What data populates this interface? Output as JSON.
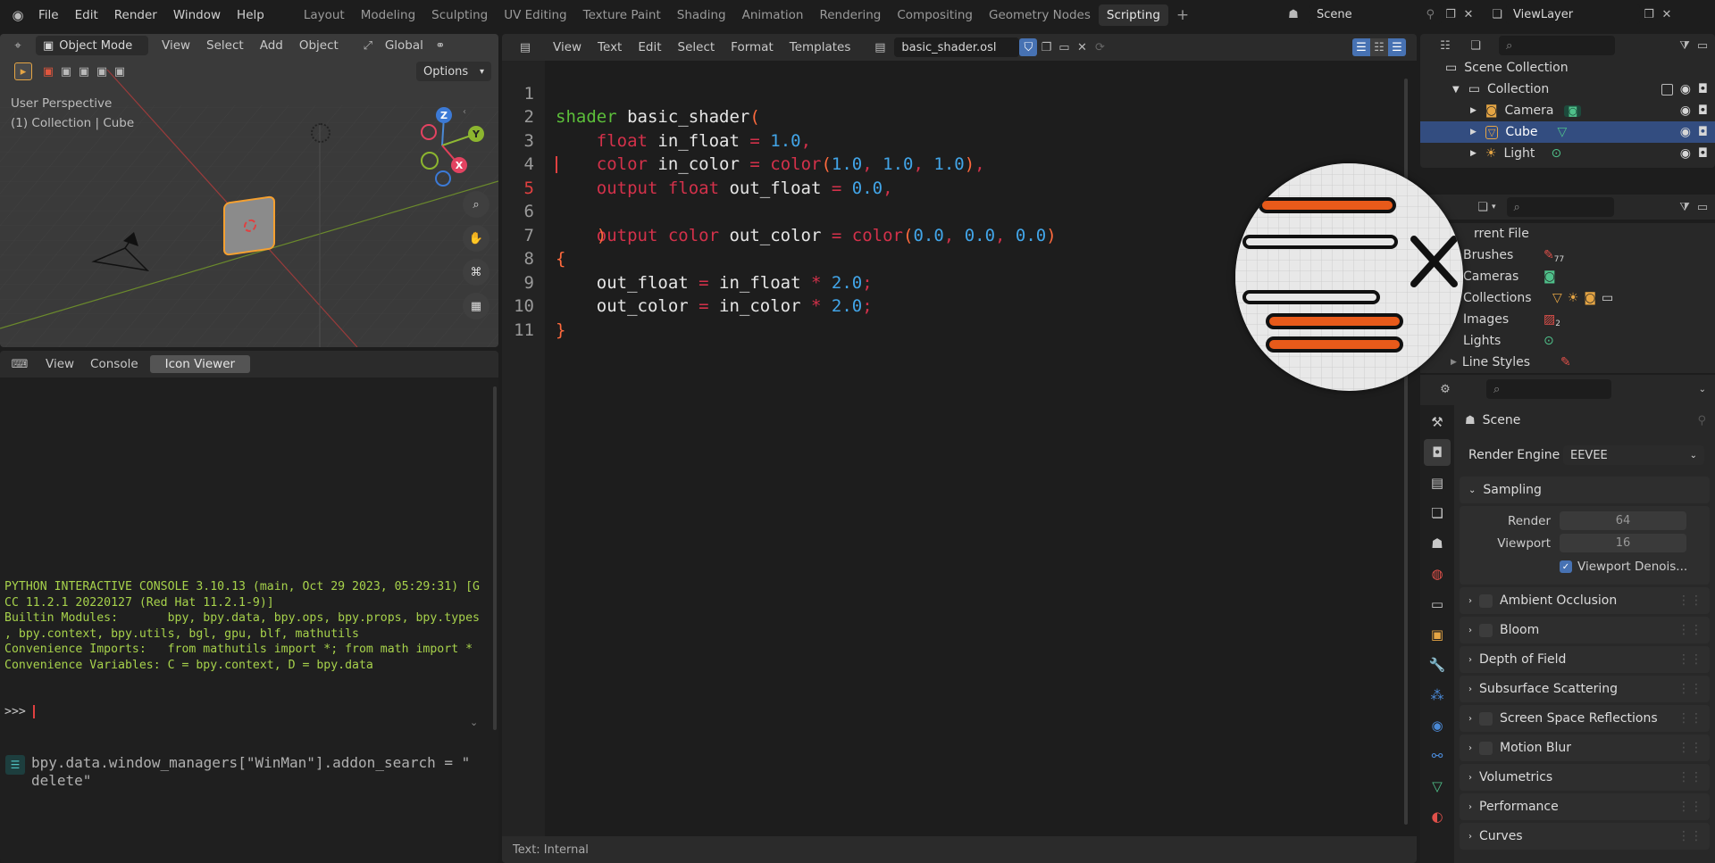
{
  "topbar": {
    "menu": [
      "File",
      "Edit",
      "Render",
      "Window",
      "Help"
    ],
    "workspaces": [
      "Layout",
      "Modeling",
      "Sculpting",
      "UV Editing",
      "Texture Paint",
      "Shading",
      "Animation",
      "Rendering",
      "Compositing",
      "Geometry Nodes",
      "Scripting"
    ],
    "active_workspace": "Scripting",
    "add_label": "+",
    "scene_name": "Scene",
    "view_layer": "ViewLayer"
  },
  "viewport": {
    "mode": "Object Mode",
    "menus": [
      "View",
      "Select",
      "Add",
      "Object"
    ],
    "transform": "Global",
    "options": "Options",
    "perspective": "User Perspective",
    "collection_info": "(1) Collection | Cube",
    "gizmo": {
      "z": "Z",
      "y": "Y",
      "x": "X"
    }
  },
  "console": {
    "menus": [
      "View",
      "Console",
      "Icon Viewer"
    ],
    "active_tab": "Icon Viewer",
    "lines": [
      "PYTHON INTERACTIVE CONSOLE 3.10.13 (main, Oct 29 2023, 05:29:31) [G",
      "CC 11.2.1 20220127 (Red Hat 11.2.1-9)]",
      "",
      "Builtin Modules:       bpy, bpy.data, bpy.ops, bpy.props, bpy.types",
      ", bpy.context, bpy.utils, bgl, gpu, blf, mathutils",
      "Convenience Imports:   from mathutils import *; from math import *",
      "Convenience Variables: C = bpy.context, D = bpy.data"
    ],
    "prompt": ">>> ",
    "info_line1": "bpy.data.window_managers[\"WinMan\"].addon_search = \"",
    "info_line2": "delete\""
  },
  "editor": {
    "menus": [
      "View",
      "Text",
      "Edit",
      "Select",
      "Format",
      "Templates"
    ],
    "filename": "basic_shader.osl",
    "status": "Text: Internal",
    "line_numbers": [
      "1",
      "2",
      "3",
      "4",
      "5",
      "6",
      "7",
      "8",
      "9",
      "10",
      "11"
    ],
    "current_line": "5"
  },
  "outliner": {
    "root": "Scene Collection",
    "collection": "Collection",
    "items": [
      "Camera",
      "Cube",
      "Light"
    ],
    "selected": "Cube"
  },
  "filebrowser": {
    "header": "rrent File",
    "items": [
      "Brushes",
      "Cameras",
      "Collections",
      "Images",
      "Lights",
      "Line Styles"
    ],
    "brushes_count": "77",
    "images_count": "2"
  },
  "properties": {
    "context": "Scene",
    "render_engine_label": "Render Engine",
    "render_engine": "EEVEE",
    "sampling": "Sampling",
    "render_label": "Render",
    "render_value": "64",
    "viewport_label": "Viewport",
    "viewport_value": "16",
    "viewport_denoise": "Viewport Denois...",
    "sections": [
      "Ambient Occlusion",
      "Bloom",
      "Depth of Field",
      "Subsurface Scattering",
      "Screen Space Reflections",
      "Motion Blur",
      "Volumetrics",
      "Performance",
      "Curves"
    ]
  },
  "colors": {
    "accent": "#4772b3",
    "selected_row": "#334d80",
    "code_bg": "#1d1d1d"
  }
}
